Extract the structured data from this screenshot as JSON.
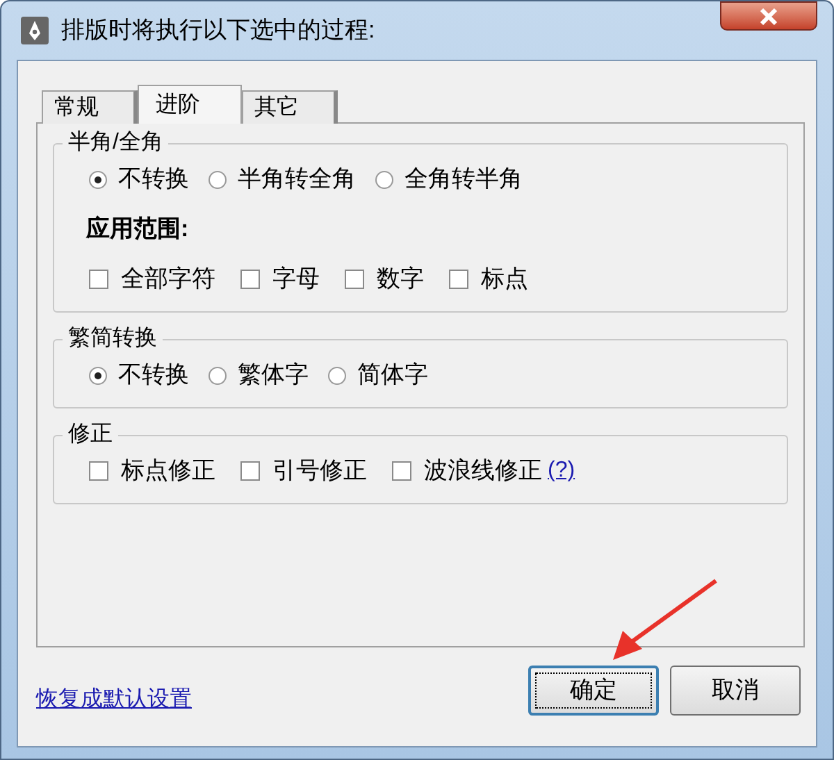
{
  "window": {
    "title": "排版时将执行以下选中的过程:"
  },
  "tabs": [
    {
      "label": "常规",
      "selected": false
    },
    {
      "label": "进阶",
      "selected": true
    },
    {
      "label": "其它",
      "selected": false
    }
  ],
  "groups": [
    {
      "title": "半角/全角",
      "rows": [
        {
          "kind": "radio",
          "items": [
            {
              "label": "不转换",
              "selected": true
            },
            {
              "label": "半角转全角",
              "selected": false
            },
            {
              "label": "全角转半角",
              "selected": false
            }
          ]
        },
        {
          "kind": "heading",
          "text": "应用范围:"
        },
        {
          "kind": "checkbox",
          "items": [
            {
              "label": "全部字符",
              "checked": false
            },
            {
              "label": "字母",
              "checked": false
            },
            {
              "label": "数字",
              "checked": false
            },
            {
              "label": "标点",
              "checked": false
            }
          ]
        }
      ]
    },
    {
      "title": "繁简转换",
      "rows": [
        {
          "kind": "radio",
          "items": [
            {
              "label": "不转换",
              "selected": true
            },
            {
              "label": "繁体字",
              "selected": false
            },
            {
              "label": "简体字",
              "selected": false
            }
          ]
        }
      ]
    },
    {
      "title": "修正",
      "rows": [
        {
          "kind": "checkbox",
          "items": [
            {
              "label": "标点修正",
              "checked": false
            },
            {
              "label": "引号修正",
              "checked": false
            },
            {
              "label": "波浪线修正",
              "checked": false,
              "help_link": "(?)"
            }
          ]
        }
      ]
    }
  ],
  "reset_link": "恢复成默认设置",
  "buttons": [
    {
      "label": "确定",
      "focused": true
    },
    {
      "label": "取消",
      "focused": false
    }
  ]
}
